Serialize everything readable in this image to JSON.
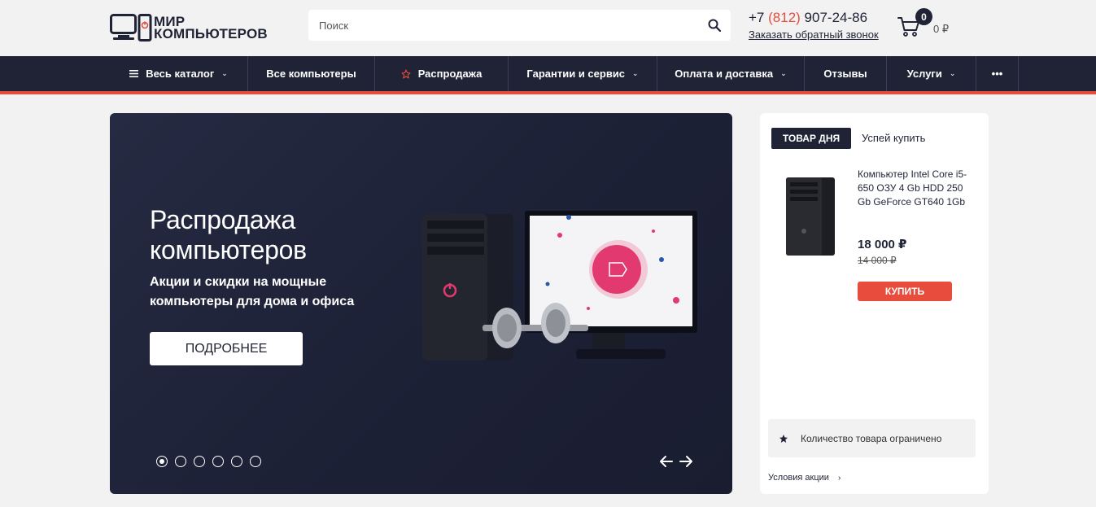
{
  "header": {
    "logo_line1": "МИР",
    "logo_line2": "КОМПЬЮТЕРОВ",
    "search_placeholder": "Поиск",
    "phone_prefix": "+7",
    "phone_code": "(812)",
    "phone_number": "907-24-86",
    "callback_label": "Заказать обратный звонок",
    "cart_count": "0",
    "cart_sum": "0 ₽"
  },
  "nav": {
    "items": [
      {
        "label": "Весь каталог"
      },
      {
        "label": "Все компьютеры"
      },
      {
        "label": "Распродажа"
      },
      {
        "label": "Гарантии и сервис"
      },
      {
        "label": "Оплата и доставка"
      },
      {
        "label": "Отзывы"
      },
      {
        "label": "Услуги"
      },
      {
        "label": "•••"
      }
    ]
  },
  "banner": {
    "title": "Распродажа компьютеров",
    "subtitle": "Акции и скидки на мощные компьютеры для дома и офиса",
    "button_label": "ПОДРОБНЕЕ",
    "slides_count": 6,
    "active_slide": 1
  },
  "product_of_day": {
    "badge": "ТОВАР ДНЯ",
    "hurry": "Успей купить",
    "name": "Компьютер Intel Core i5-650 ОЗУ 4 Gb HDD 250 Gb GeForce GT640 1Gb",
    "price_new": "18 000 ₽",
    "price_old": "14 000 ₽",
    "buy_label": "КУПИТЬ",
    "limited_note": "Количество товара ограничено",
    "terms_label": "Условия акции"
  },
  "colors": {
    "primary": "#1f2335",
    "accent": "#e74c3c",
    "background": "#f2f2f2"
  }
}
